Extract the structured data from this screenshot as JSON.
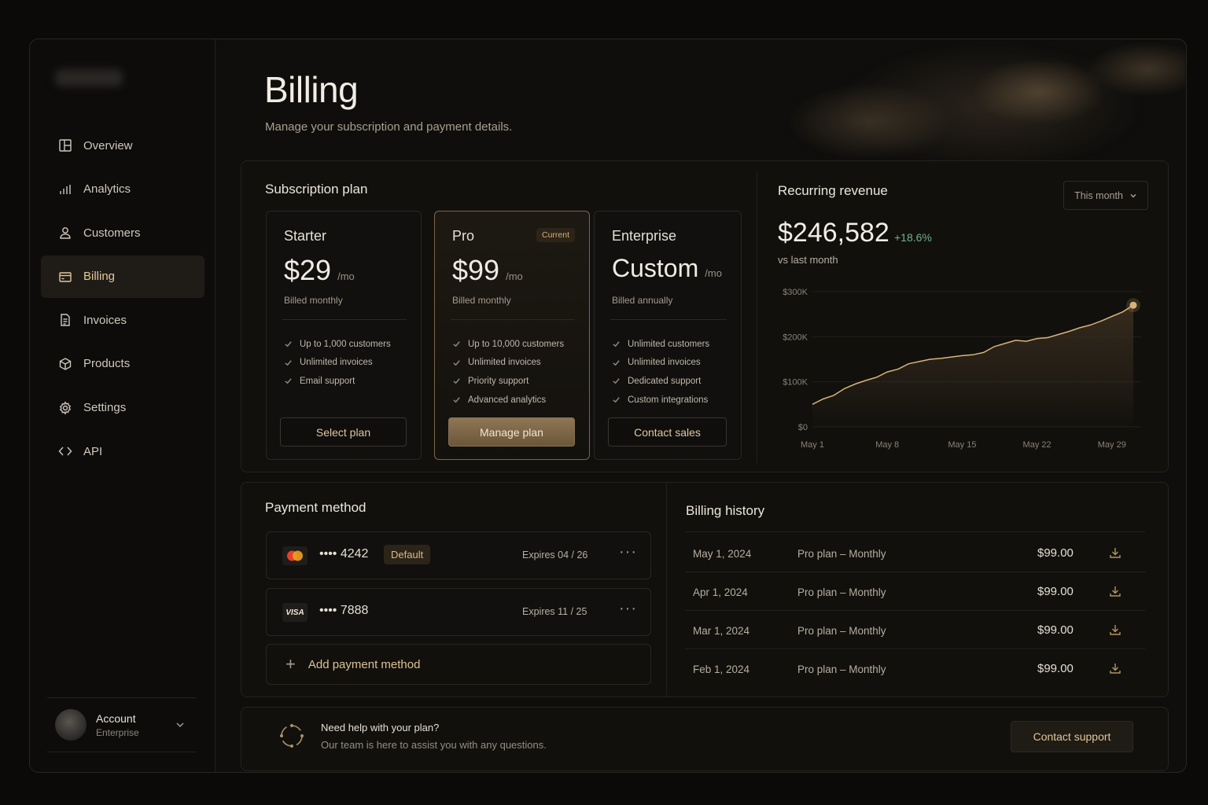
{
  "sidebar": {
    "items": [
      {
        "label": "Overview",
        "icon": "layout-icon"
      },
      {
        "label": "Analytics",
        "icon": "bar-chart-icon"
      },
      {
        "label": "Customers",
        "icon": "user-icon"
      },
      {
        "label": "Billing",
        "icon": "credit-card-icon",
        "active": true
      },
      {
        "label": "Invoices",
        "icon": "document-icon"
      },
      {
        "label": "Products",
        "icon": "box-icon"
      },
      {
        "label": "Settings",
        "icon": "gear-icon"
      },
      {
        "label": "API",
        "icon": "code-icon"
      }
    ],
    "account": {
      "name": "Account",
      "plan": "Enterprise"
    }
  },
  "header": {
    "title": "Billing",
    "subtitle": "Manage your subscription and payment details."
  },
  "subscription": {
    "title": "Subscription plan",
    "plans": [
      {
        "name": "Starter",
        "price": "$29",
        "period": "/mo",
        "billing": "Billed monthly",
        "features": [
          "Up to 1,000 customers",
          "Unlimited invoices",
          "Email support"
        ],
        "button": "Select plan"
      },
      {
        "name": "Pro",
        "badge": "Current",
        "price": "$99",
        "period": "/mo",
        "billing": "Billed monthly",
        "features": [
          "Up to 10,000 customers",
          "Unlimited invoices",
          "Priority support",
          "Advanced analytics"
        ],
        "button": "Manage plan"
      },
      {
        "name": "Enterprise",
        "price": "Custom",
        "period": "/mo",
        "billing": "Billed annually",
        "features": [
          "Unlimited customers",
          "Unlimited invoices",
          "Dedicated support",
          "Custom integrations"
        ],
        "button": "Contact sales"
      }
    ]
  },
  "revenue": {
    "title": "Recurring revenue",
    "period_select": "This month",
    "amount": "$246,582",
    "change": "+18.6%",
    "comparison": "vs last month"
  },
  "chart_data": {
    "type": "area",
    "ylim": [
      0,
      300000
    ],
    "yticks": [
      "$300K",
      "$200K",
      "$100K",
      "$0"
    ],
    "xticks": [
      "May 1",
      "May 8",
      "May 15",
      "May 22",
      "May 29"
    ],
    "x": [
      1,
      2,
      3,
      4,
      5,
      6,
      7,
      8,
      9,
      10,
      11,
      12,
      13,
      14,
      15,
      16,
      17,
      18,
      19,
      20,
      21,
      22,
      23,
      24,
      25,
      26,
      27,
      28,
      29,
      30,
      31
    ],
    "values": [
      50000,
      62000,
      70000,
      85000,
      95000,
      103000,
      110000,
      122000,
      128000,
      140000,
      145000,
      150000,
      152000,
      155000,
      158000,
      160000,
      165000,
      178000,
      185000,
      192000,
      190000,
      196000,
      198000,
      205000,
      212000,
      220000,
      226000,
      235000,
      245000,
      255000,
      270000
    ],
    "colors": {
      "line": "#d9b27a",
      "fill": "#3a2e1f"
    }
  },
  "payment": {
    "title": "Payment method",
    "methods": [
      {
        "brand": "mastercard-logo",
        "number": "•••• 4242",
        "default_label": "Default",
        "expires": "Expires 04 / 26"
      },
      {
        "brand": "visa-logo",
        "brand_text": "VISA",
        "number": "•••• 7888",
        "expires": "Expires 11 / 25"
      }
    ],
    "add_label": "Add payment method"
  },
  "history": {
    "title": "Billing history",
    "rows": [
      {
        "date": "May 1, 2024",
        "plan": "Pro plan – Monthly",
        "amount": "$99.00"
      },
      {
        "date": "Apr 1, 2024",
        "plan": "Pro plan – Monthly",
        "amount": "$99.00"
      },
      {
        "date": "Mar 1, 2024",
        "plan": "Pro plan – Monthly",
        "amount": "$99.00"
      },
      {
        "date": "Feb 1, 2024",
        "plan": "Pro plan – Monthly",
        "amount": "$99.00"
      }
    ]
  },
  "help": {
    "title": "Need help with your plan?",
    "text": "Our team is here to assist you with any questions.",
    "button": "Contact support"
  },
  "colors": {
    "accent": "#d9b27a",
    "positive": "#6fb08c",
    "background": "#0f0e0c"
  }
}
